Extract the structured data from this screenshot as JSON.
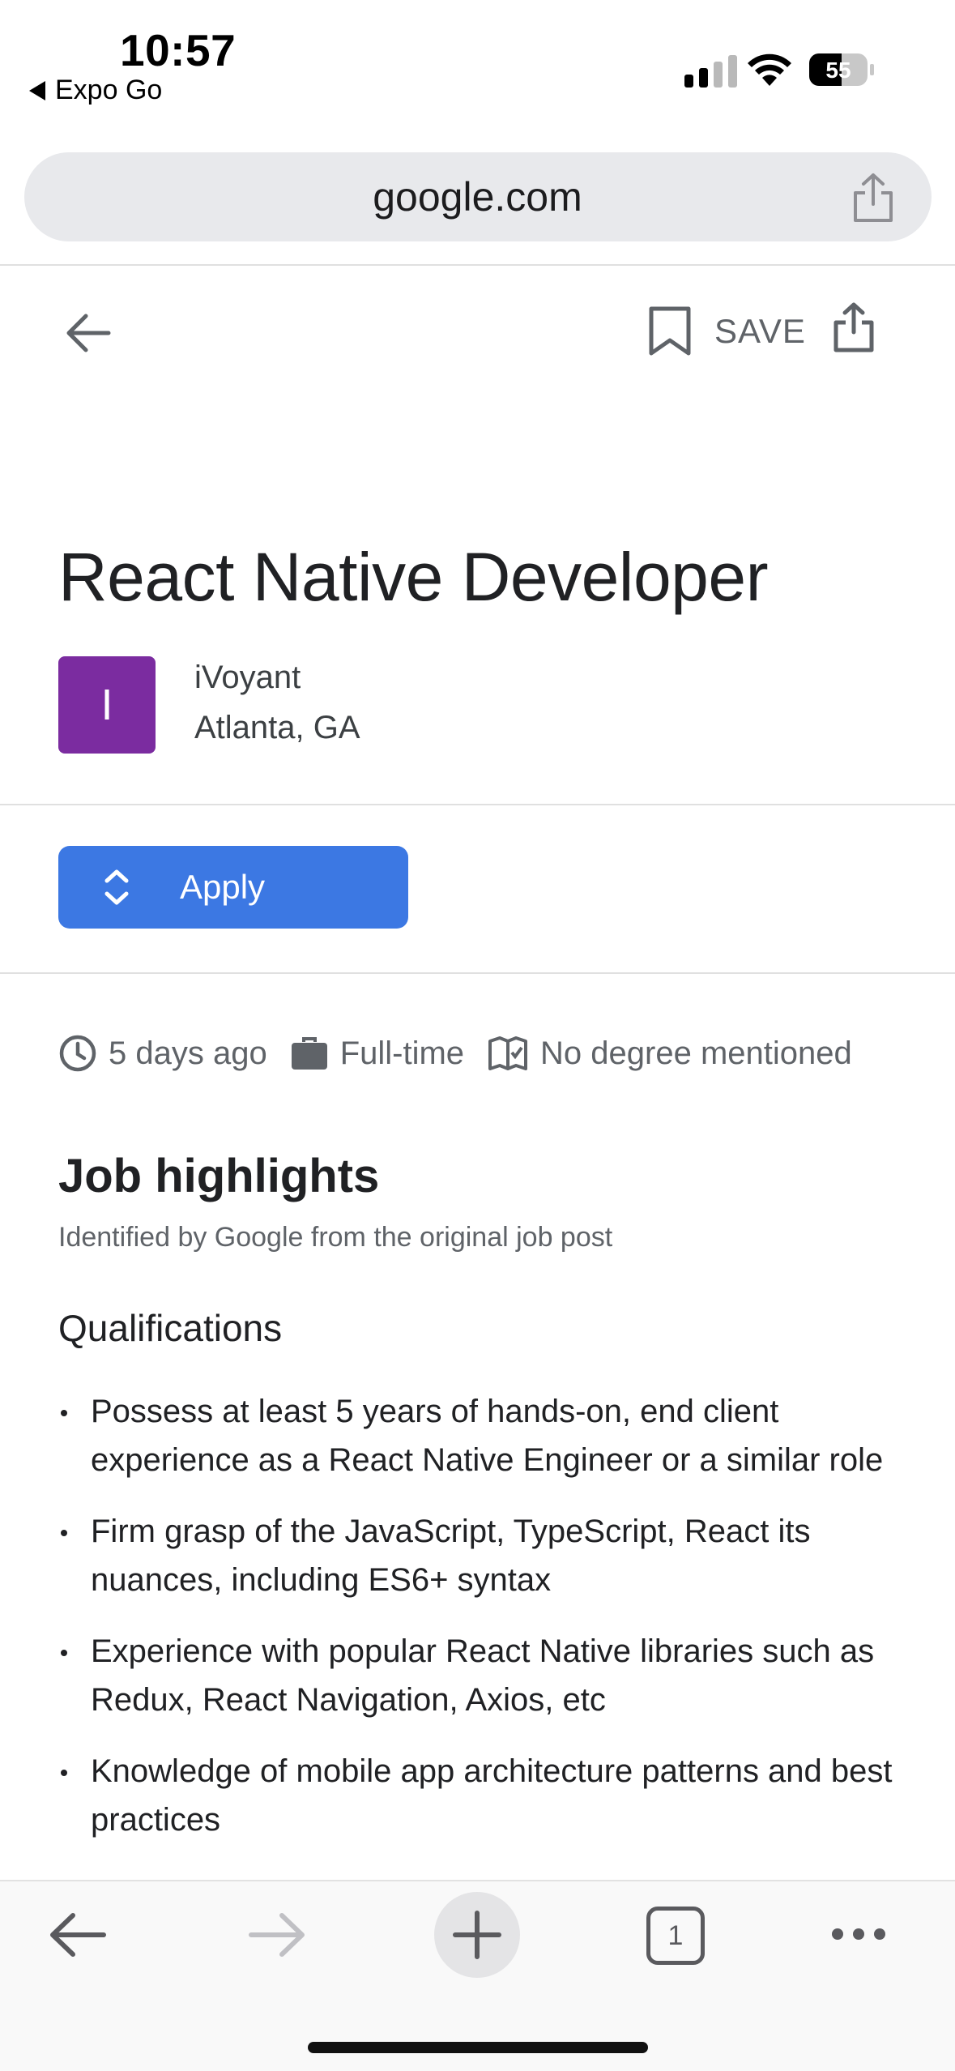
{
  "status_bar": {
    "time": "10:57",
    "back_app": "Expo Go",
    "battery": "55"
  },
  "browser": {
    "url": "google.com",
    "tab_count": "1"
  },
  "job": {
    "save_label": "SAVE",
    "title": "React Native Developer",
    "logo_letter": "I",
    "company": "iVoyant",
    "location": "Atlanta, GA",
    "apply_label": "Apply",
    "posted": "5 days ago",
    "type": "Full-time",
    "degree": "No degree mentioned",
    "highlights_title": "Job highlights",
    "highlights_sub": "Identified by Google from the original job post",
    "qualifications_title": "Qualifications",
    "qualifications": [
      "Possess at least 5 years of hands-on, end client experience as a React Native Engineer or a similar role",
      "Firm grasp of the JavaScript, TypeScript, React its nuances, including ES6+ syntax",
      "Experience with popular React Native libraries such as Redux, React Navigation, Axios, etc",
      "Knowledge of mobile app architecture patterns and best practices"
    ]
  },
  "colors": {
    "apply_button": "#3c78e3",
    "logo_bg": "#7b2ca0",
    "muted_text": "#5f6368"
  },
  "icons": [
    "back-arrow-icon",
    "bookmark-icon",
    "share-icon",
    "clock-icon",
    "briefcase-icon",
    "degree-book-icon",
    "expand-chevrons-icon",
    "plus-icon",
    "more-dots-icon"
  ]
}
